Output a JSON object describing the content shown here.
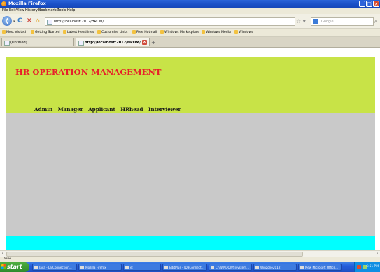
{
  "window": {
    "title": "Mozilla Firefox",
    "minimize": "_",
    "maximize": "□",
    "close": "×"
  },
  "menu": [
    "File",
    "Edit",
    "View",
    "History",
    "Bookmarks",
    "Tools",
    "Help"
  ],
  "nav": {
    "back": "❮",
    "dropdown": "▾",
    "reload": "C",
    "stop": "✕",
    "home": "⌂",
    "url": "http://localhost:2012/HROM/",
    "star": "☆ ▾",
    "search_placeholder": "Google",
    "search": "⌕"
  },
  "bookmarks": [
    "Most Visited",
    "Getting Started",
    "Latest Headlines",
    "Customize Links",
    "Free Hotmail",
    "Windows Marketplace",
    "Windows Media",
    "Windows"
  ],
  "tabs": [
    {
      "label": "(Untitled)"
    },
    {
      "label": "http://localhost:2012/HROM/",
      "close": "x"
    }
  ],
  "newtab": "+",
  "page": {
    "title": "HR OPERATION MANAGEMENT",
    "links": [
      "Admin",
      "Manager",
      "Applicant",
      "HRhead",
      "Interviewer"
    ]
  },
  "scroll": {
    "left": "‹",
    "right": "›"
  },
  "status": "Done",
  "taskbar": {
    "start": "start",
    "tasks": [
      "Java - DBConnection...",
      "Mozilla Firefox",
      "e:",
      "EditPlus - [DBConnect...",
      "C:\\WINDOWS\\system...",
      "Winzone2012",
      "New Microsoft Office..."
    ],
    "clock": "6:51 PM"
  }
}
